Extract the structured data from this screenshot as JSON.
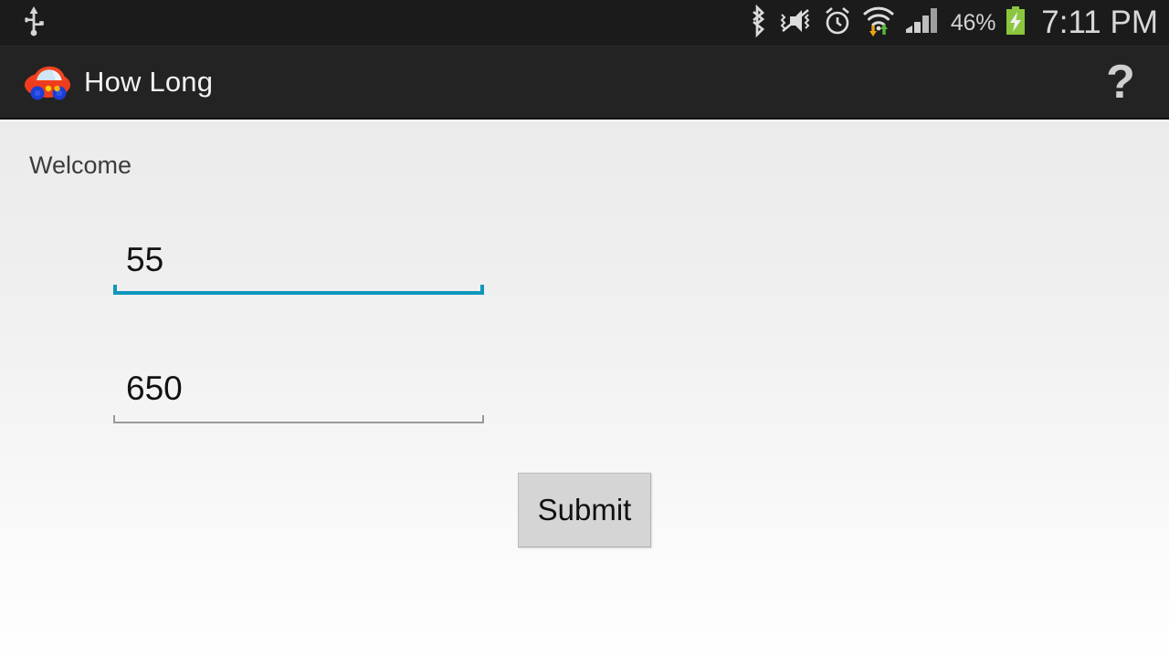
{
  "status_bar": {
    "left_icons": [
      {
        "name": "usb-icon",
        "label": "USB connected"
      }
    ],
    "right_icons": [
      {
        "name": "bluetooth-icon",
        "label": "Bluetooth"
      },
      {
        "name": "volume-mute-vibrate-icon",
        "label": "Silent / vibrate"
      },
      {
        "name": "alarm-clock-icon",
        "label": "Alarm set"
      },
      {
        "name": "wifi-icon",
        "label": "Wi-Fi with data transfer"
      },
      {
        "name": "cellular-signal-icon",
        "label": "Cellular signal"
      }
    ],
    "battery_percent": "46%",
    "battery_state": "charging",
    "clock": "7:11 PM"
  },
  "action_bar": {
    "app_icon": "car-app-icon",
    "title": "How Long",
    "help_label": "?"
  },
  "content": {
    "welcome_label": "Welcome",
    "fields": [
      {
        "name": "input-distance",
        "value": "55",
        "placeholder": "",
        "focused": true
      },
      {
        "name": "input-time",
        "value": "650",
        "placeholder": "",
        "focused": false
      }
    ],
    "submit_label": "Submit"
  },
  "colors": {
    "status_bar_bg": "#1b1b1b",
    "action_bar_bg": "#232323",
    "accent": "#0f96bd",
    "field_underline_inactive": "#9a9a9a",
    "button_bg": "#d5d5d5",
    "battery_green": "#8cc63f",
    "text_light": "#d8d8d8",
    "text_dark": "#111111"
  }
}
